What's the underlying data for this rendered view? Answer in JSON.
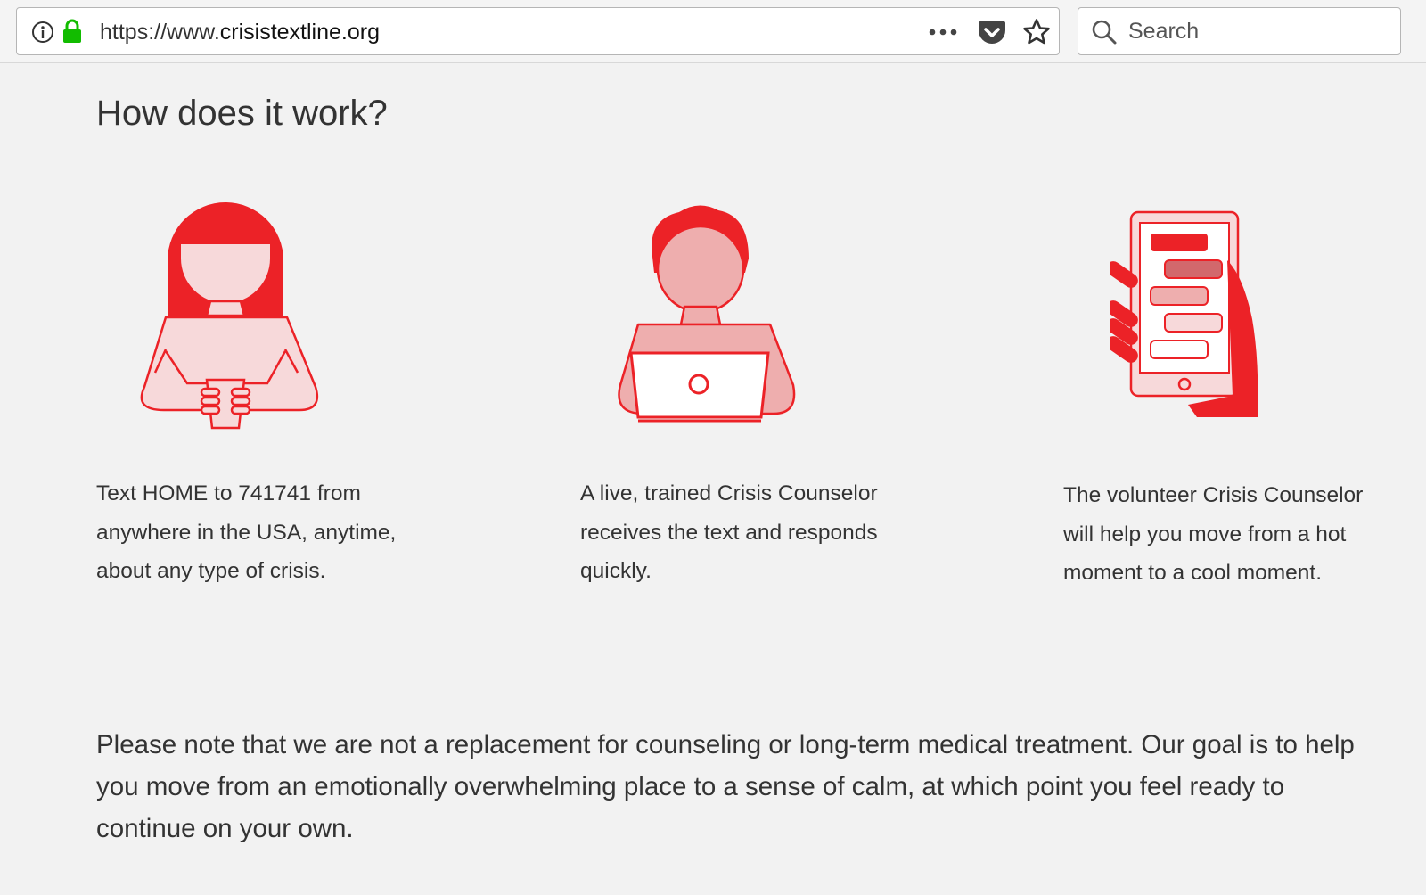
{
  "browser": {
    "url_prefix": "https://www.",
    "url_domain": "crisistextline.org",
    "search_placeholder": "Search",
    "icons": [
      "info-icon",
      "lock-icon",
      "more-icon",
      "pocket-icon",
      "star-icon",
      "search-icon"
    ]
  },
  "page": {
    "heading": "How does it work?",
    "steps": [
      {
        "illustration": "person-texting-illustration",
        "text": "Text HOME to 741741 from anywhere in the USA, anytime, about any type of crisis."
      },
      {
        "illustration": "counselor-laptop-illustration",
        "text": "A live, trained Crisis Counselor receives the text and responds quickly."
      },
      {
        "illustration": "phone-chat-illustration",
        "text": "The volunteer Crisis Counselor will help you move from a hot moment to a cool moment."
      }
    ],
    "note": "Please note that we are not a replacement for counseling or long-term medical treatment. Our goal is to help you move from an emotionally overwhelming place to a sense of calm, at which point you feel ready to continue on your own."
  },
  "colors": {
    "brand_red": "#ec2227",
    "light_pink": "#f7d9da",
    "mid_pink": "#eeaeae",
    "dark_pink": "#d2686c",
    "lock_green": "#12bc00",
    "background": "#f2f2f2"
  }
}
